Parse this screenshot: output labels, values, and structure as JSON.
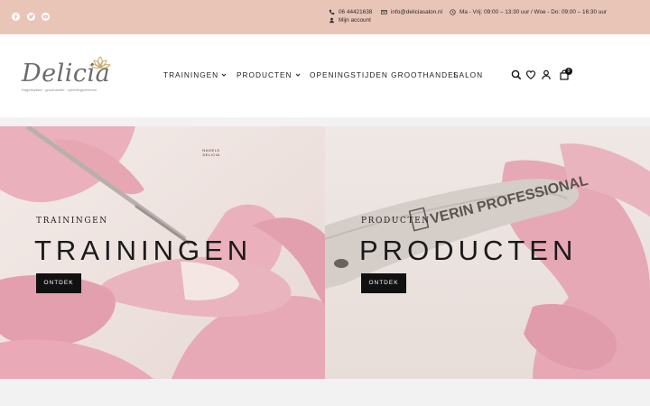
{
  "topbar": {
    "phone": "06 44421638",
    "email": "info@deliciasalon.nl",
    "hours": "Ma - Vrij: 09:00 – 13:30 uur / Woe - Do: 09:00 – 16:30 uur",
    "account": "Mijn account",
    "social": [
      "facebook-icon",
      "twitter-icon",
      "youtube-icon"
    ]
  },
  "header": {
    "logo_text": "Delicia",
    "logo_sub": "Nagelstyliste · groothandel · opleidingscentrum",
    "nav": {
      "trainingen": "TRAININGEN",
      "producten": "PRODUCTEN",
      "openingstijden": "OPENINGSTIJDEN GROOTHANDEL",
      "salon": "SALON"
    },
    "cart_count": "0"
  },
  "hero": {
    "left": {
      "kicker": "TRAININGEN",
      "title": "TRAININGEN",
      "button": "ONTDEK",
      "badge": "NAGELS DELICIA"
    },
    "right": {
      "kicker": "PRODUCTEN",
      "title": "PRODUCTEN",
      "button": "ONTDEK",
      "product_text": "VERIN PROFESSIONAL"
    }
  },
  "colors": {
    "topbar": "#e9c5b8",
    "glove": "#e7a9b5",
    "button": "#111111"
  }
}
